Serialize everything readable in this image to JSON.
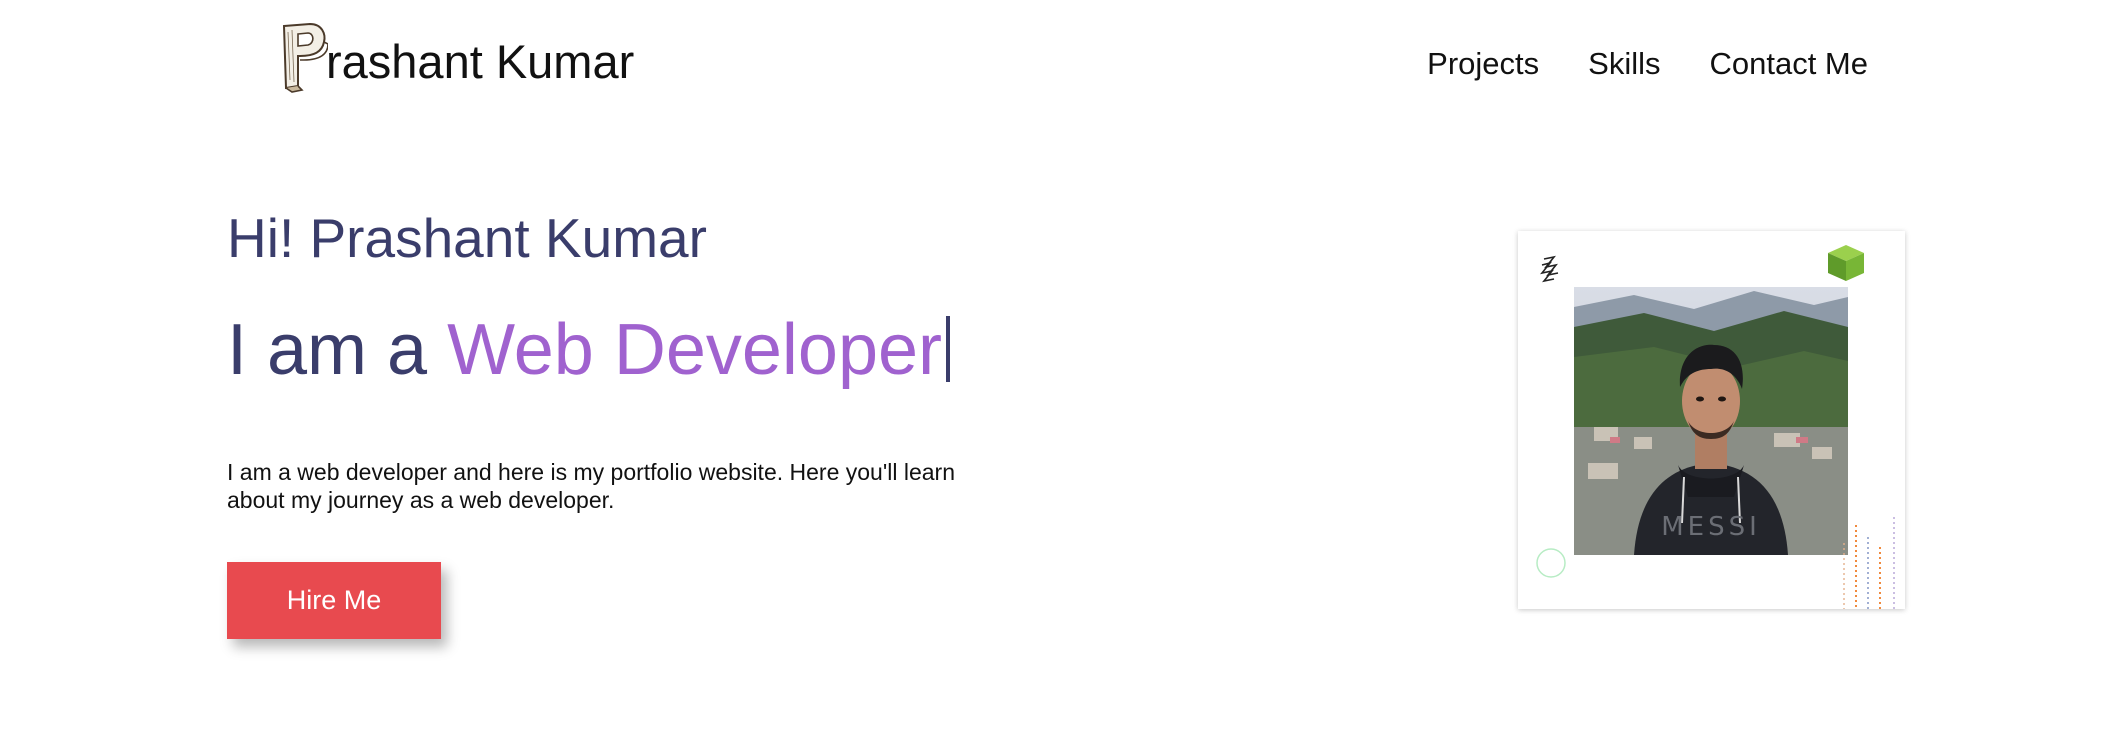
{
  "header": {
    "logo_text": "rashant Kumar",
    "nav": [
      {
        "label": "Projects"
      },
      {
        "label": "Skills"
      },
      {
        "label": "Contact Me"
      }
    ]
  },
  "hero": {
    "greeting": "Hi! Prashant Kumar",
    "role_prefix": "I am a ",
    "role_word": "Web Developer",
    "intro": "I am a web developer and here is my portfolio website. Here you'll learn about my journey as a web developer.",
    "cta_label": "Hire Me"
  },
  "colors": {
    "heading": "#3a3d6b",
    "accent": "#a062cf",
    "button": "#e84a4f"
  },
  "profile": {
    "photo_shirt_text": "MESSI"
  },
  "icons": {
    "logo": "hand-drawn-p-logo",
    "corner_top_left": "zigzag-icon",
    "corner_top_right": "green-cube-icon",
    "corner_bottom_left": "circle-outline-icon",
    "corner_bottom_right": "dotted-lines-decoration"
  }
}
